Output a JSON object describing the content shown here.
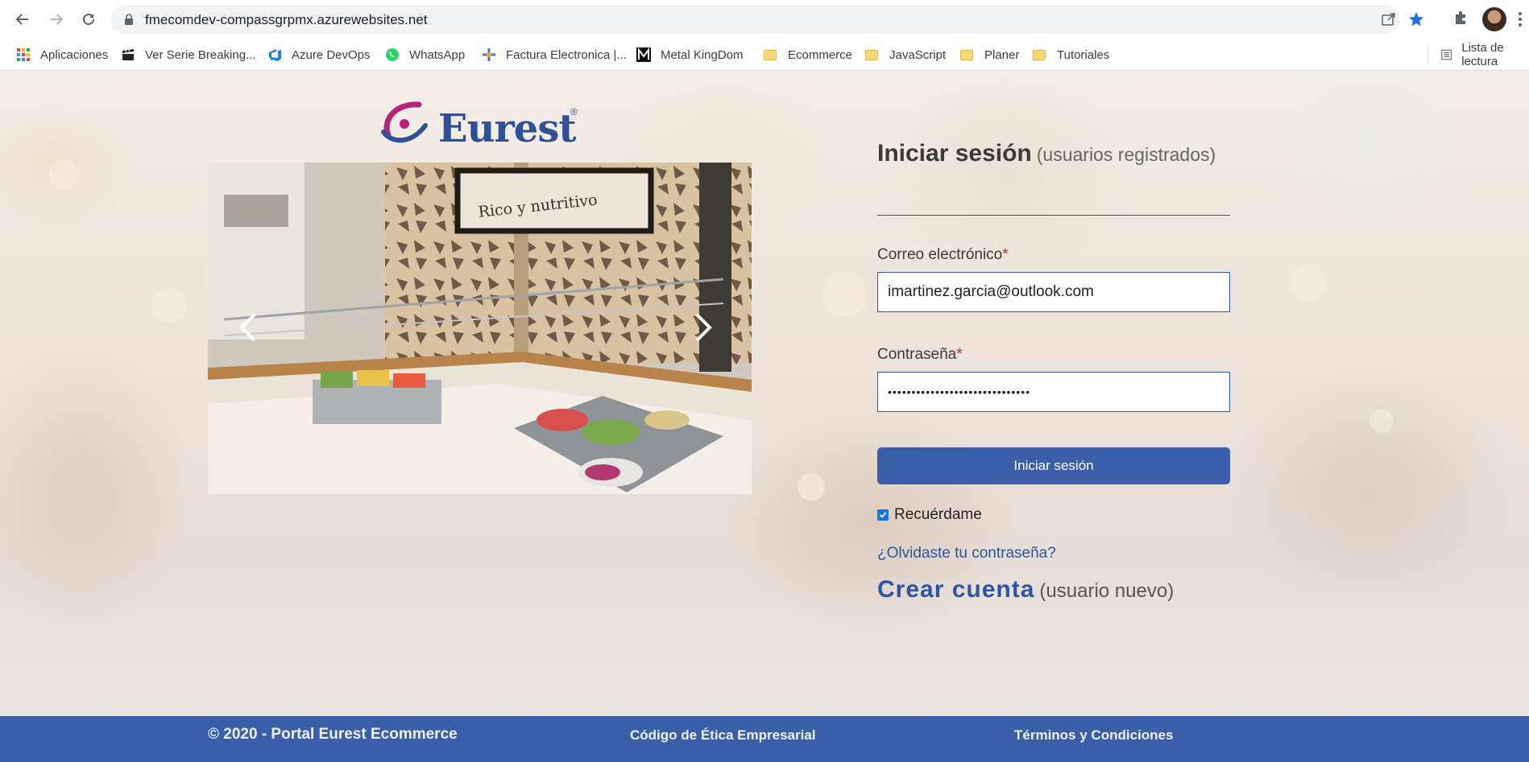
{
  "browser": {
    "url": "fmecomdev-compassgrpmx.azurewebsites.net",
    "bookmarks": [
      {
        "label": "Aplicaciones",
        "icon": "apps-grid-icon"
      },
      {
        "label": "Ver Serie Breaking...",
        "icon": "film-icon"
      },
      {
        "label": "Azure DevOps",
        "icon": "azure-devops-icon"
      },
      {
        "label": "WhatsApp",
        "icon": "whatsapp-icon"
      },
      {
        "label": "Factura Electronica |...",
        "icon": "factura-icon"
      },
      {
        "label": "Metal KingDom",
        "icon": "metal-m-icon"
      },
      {
        "label": "Ecommerce",
        "icon": "folder-icon"
      },
      {
        "label": "JavaScript",
        "icon": "folder-icon"
      },
      {
        "label": "Planer",
        "icon": "folder-icon"
      },
      {
        "label": "Tutoriales",
        "icon": "folder-icon"
      }
    ],
    "reading_list": "Lista de lectura"
  },
  "colors": {
    "brand_blue": "#3a5ea7",
    "link_blue": "#2e55a5",
    "required_red": "#d21f1f"
  },
  "logo": {
    "text": "Eurest",
    "registered": "®"
  },
  "login": {
    "title": "Iniciar sesión",
    "subtitle": "(usuarios registrados)",
    "email_label": "Correo electrónico",
    "email_value": "imartinez.garcia@outlook.com",
    "password_label": "Contraseña",
    "password_value": "••••••••••••••••••••••••••••••",
    "required_mark": "*",
    "submit_label": "Iniciar sesión",
    "remember_label": "Recuérdame",
    "remember_checked": true,
    "forgot_link": "¿Olvidaste tu contraseña?",
    "create_link": "Crear cuenta",
    "create_sub": "(usuario nuevo)"
  },
  "carousel": {
    "sign_text": "Rico y nutritivo"
  },
  "footer": {
    "copyright": "© 2020 - Portal Eurest Ecommerce",
    "ethics_link": "Código de Ética Empresarial",
    "terms_link": "Términos y Condiciones"
  }
}
